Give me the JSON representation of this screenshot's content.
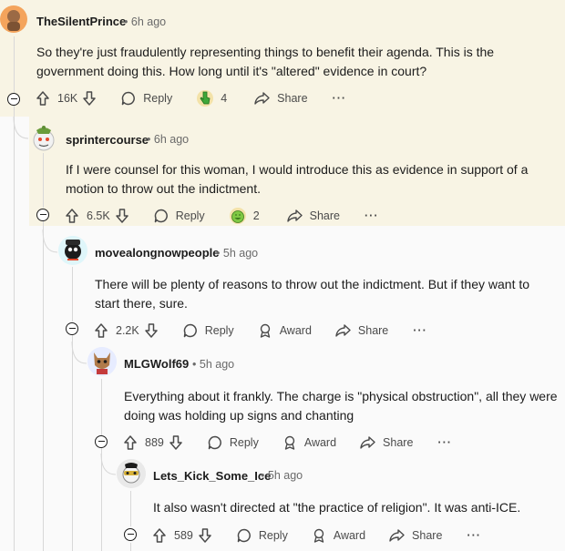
{
  "comments": [
    {
      "username": "TheSilentPrince",
      "time": "6h ago",
      "body": "So they're just fraudulently representing things to benefit their agenda. This is the government doing this. How long until it's \"altered\" evidence in court?",
      "votes": "16K",
      "reply_label": "Reply",
      "award_count": "4",
      "share_label": "Share",
      "more_label": "···"
    },
    {
      "username": "sprintercourse",
      "time": "6h ago",
      "body": "If I were counsel for this woman, I would introduce this as evidence in support of a motion to throw out the indictment.",
      "votes": "6.5K",
      "reply_label": "Reply",
      "award_count": "2",
      "share_label": "Share",
      "more_label": "···"
    },
    {
      "username": "movealongnowpeople",
      "time": "5h ago",
      "body": "There will be plenty of reasons to throw out the indictment. But if they want to start there, sure.",
      "votes": "2.2K",
      "reply_label": "Reply",
      "award_label": "Award",
      "share_label": "Share",
      "more_label": "···"
    },
    {
      "username": "MLGWolf69",
      "time": "5h ago",
      "body": "Everything about it frankly. The charge is \"physical obstruction\", all they were doing was holding up signs and chanting",
      "votes": "889",
      "reply_label": "Reply",
      "award_label": "Award",
      "share_label": "Share",
      "more_label": "···"
    },
    {
      "username": "Lets_Kick_Some_Ice",
      "time": "5h ago",
      "body": "It also wasn't directed at \"the practice of religion\". It was anti-ICE.",
      "votes": "589",
      "reply_label": "Reply",
      "award_label": "Award",
      "share_label": "Share",
      "more_label": "···"
    }
  ],
  "dot_separator": "•",
  "icons": [
    "upvote-icon",
    "downvote-icon",
    "reply-icon",
    "award-icon",
    "share-icon",
    "more-icon",
    "collapse-icon"
  ]
}
